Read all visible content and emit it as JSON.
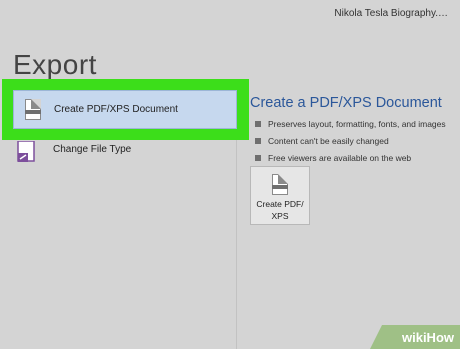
{
  "window": {
    "doc_title": "Nikola Tesla Biography.…"
  },
  "page": {
    "title": "Export"
  },
  "left_options": [
    {
      "label": "Create PDF/XPS Document",
      "icon": "pdf-doc-icon",
      "selected": true
    },
    {
      "label": "Change File Type",
      "icon": "change-file-type-icon",
      "selected": false
    }
  ],
  "detail": {
    "title": "Create a PDF/XPS Document",
    "bullets": [
      "Preserves layout, formatting, fonts, and images",
      "Content can't be easily changed",
      "Free viewers are available on the web"
    ],
    "button": {
      "line1": "Create PDF/",
      "line2": "XPS"
    }
  },
  "watermark": {
    "brand": "wikiHow"
  },
  "colors": {
    "highlight": "#3cde1a",
    "selected_bg": "#c6d8ee",
    "title_blue": "#2b579a"
  }
}
